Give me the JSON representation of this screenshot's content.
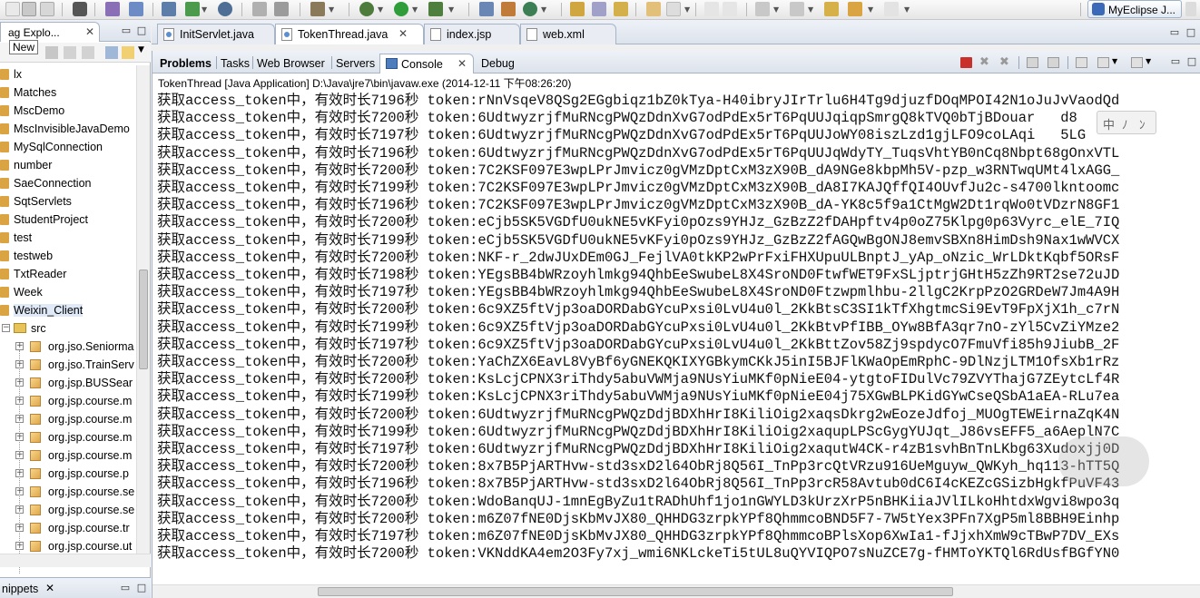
{
  "toolbar": {
    "perspective_label": "MyEclipse J...",
    "icons": [
      "new-icon",
      "save-icon",
      "print-icon",
      "debug-icon",
      "run-icon",
      "server-icon",
      "deploy-icon",
      "search-icon",
      "back-icon",
      "forward-icon"
    ]
  },
  "tooltip": {
    "text": "New"
  },
  "package_explorer": {
    "tab_label": "ag Explo...",
    "tab_close": "✕",
    "items": [
      {
        "label": "lx",
        "kind": "project"
      },
      {
        "label": "Matches",
        "kind": "project"
      },
      {
        "label": "MscDemo",
        "kind": "project"
      },
      {
        "label": "MscInvisibleJavaDemo",
        "kind": "project"
      },
      {
        "label": "MySqlConnection",
        "kind": "project"
      },
      {
        "label": "number",
        "kind": "project"
      },
      {
        "label": "SaeConnection",
        "kind": "project"
      },
      {
        "label": "SqtServlets",
        "kind": "project"
      },
      {
        "label": "StudentProject",
        "kind": "project"
      },
      {
        "label": "test",
        "kind": "project"
      },
      {
        "label": "testweb",
        "kind": "project"
      },
      {
        "label": "TxtReader",
        "kind": "project"
      },
      {
        "label": "Week",
        "kind": "project"
      },
      {
        "label": "Weixin_Client",
        "kind": "project",
        "selected": true
      },
      {
        "label": "src",
        "kind": "src"
      },
      {
        "label": "org.jso.Seniorma",
        "kind": "package"
      },
      {
        "label": "org.jso.TrainServ",
        "kind": "package"
      },
      {
        "label": "org.jsp.BUSSear",
        "kind": "package"
      },
      {
        "label": "org.jsp.course.m",
        "kind": "package"
      },
      {
        "label": "org.jsp.course.m",
        "kind": "package"
      },
      {
        "label": "org.jsp.course.m",
        "kind": "package"
      },
      {
        "label": "org.jsp.course.m",
        "kind": "package"
      },
      {
        "label": "org.jsp.course.p",
        "kind": "package"
      },
      {
        "label": "org.jsp.course.se",
        "kind": "package"
      },
      {
        "label": "org.jsp.course.se",
        "kind": "package"
      },
      {
        "label": "org.jsp.course.tr",
        "kind": "package"
      },
      {
        "label": "org.jsp.course.ut",
        "kind": "package"
      }
    ]
  },
  "snippets": {
    "label": "nippets",
    "close": "✕"
  },
  "editor_tabs": [
    {
      "label": "InitServlet.java",
      "type": "java"
    },
    {
      "label": "TokenThread.java",
      "type": "java",
      "active": true,
      "close": "✕"
    },
    {
      "label": "index.jsp",
      "type": "jsp"
    },
    {
      "label": "web.xml",
      "type": "xml"
    }
  ],
  "console": {
    "tabs": [
      "Problems",
      "Tasks",
      "Web Browser",
      "Servers",
      "Console",
      "Debug"
    ],
    "active_tab": "Console",
    "close": "✕",
    "header": "TokenThread [Java Application] D:\\Java\\jre7\\bin\\javaw.exe (2014-12-11 下午08:26:20)",
    "ime_chars": [
      "中",
      "ﾉ",
      "ﾝ"
    ],
    "lines": [
      "获取access_token中，有效时长7196秒 token:rNnVsqeV8QSg2EGgbiqz1bZ0kTya-H40ibryJIrTrlu6H4Tg9djuzfDOqMPOI42N1oJuJvVaodQd",
      "获取access_token中，有效时长7200秒 token:6UdtwyzrjfMuRNcgPWQzDdnXvG7odPdEx5rT6PqUUJqiqpSmrgQ8kTVQ0bTjBDouar   d8",
      "获取access_token中，有效时长7197秒 token:6UdtwyzrjfMuRNcgPWQzDdnXvG7odPdEx5rT6PqUUJoWY08iszLzd1gjLFO9coLAqi   5LG",
      "获取access_token中，有效时长7196秒 token:6UdtwyzrjfMuRNcgPWQzDdnXvG7odPdEx5rT6PqUUJqWdyTY_TuqsVhtYB0nCq8Nbpt68gOnxVTL",
      "获取access_token中，有效时长7200秒 token:7C2KSF097E3wpLPrJmvicz0gVMzDptCxM3zX90B_dA9NGe8kbpMh5V-pzp_w3RNTwqUMt4lxAGG_",
      "获取access_token中，有效时长7199秒 token:7C2KSF097E3wpLPrJmvicz0gVMzDptCxM3zX90B_dA8I7KAJQffQI4OUvfJu2c-s4700lkntoomc",
      "获取access_token中，有效时长7196秒 token:7C2KSF097E3wpLPrJmvicz0gVMzDptCxM3zX90B_dA-YK8c5f9a1CtMgW2Dt1rqWo0tVDzrN8GF1",
      "获取access_token中，有效时长7200秒 token:eCjb5SK5VGDfU0ukNE5vKFyi0pOzs9YHJz_GzBzZ2fDAHpftv4p0oZ75Klpg0p63Vyrc_elE_7IQ",
      "获取access_token中，有效时长7199秒 token:eCjb5SK5VGDfU0ukNE5vKFyi0pOzs9YHJz_GzBzZ2fAGQwBgONJ8emvSBXn8HimDsh9Nax1wWVCX",
      "获取access_token中，有效时长7200秒 token:NKF-r_2dwJUxDEm0GJ_FejlVA0tkKP2wPrFxiFHXUpuULBnptJ_yAp_oNzic_WrLDktKqbf5ORsF",
      "获取access_token中，有效时长7198秒 token:YEgsBB4bWRzoyhlmkg94QhbEeSwubeL8X4SroND0FtwfWET9FxSLjptrjGHtH5zZh9RT2se72uJD",
      "获取access_token中，有效时长7197秒 token:YEgsBB4bWRzoyhlmkg94QhbEeSwubeL8X4SroND0Ftzwpmlhbu-2llgC2KrpPzO2GRDeW7Jm4A9H",
      "获取access_token中，有效时长7200秒 token:6c9XZ5ftVjp3oaDORDabGYcuPxsi0LvU4u0l_2KkBtsC3SI1kTfXhgtmcSi9EvT9FpXjX1h_c7rN",
      "获取access_token中，有效时长7199秒 token:6c9XZ5ftVjp3oaDORDabGYcuPxsi0LvU4u0l_2KkBtvPfIBB_OYw8BfA3qr7nO-zYl5CvZiYMze2",
      "获取access_token中，有效时长7197秒 token:6c9XZ5ftVjp3oaDORDabGYcuPxsi0LvU4u0l_2KkBttZov58Zj9spdycO7FmuVfi85h9JiubB_2F",
      "获取access_token中，有效时长7200秒 token:YaChZX6EavL8VyBf6yGNEKQKIXYGBkymCKkJ5inI5BJFlKWaOpEmRphC-9DlNzjLTM1OfsXb1rRz",
      "获取access_token中，有效时长7200秒 token:KsLcjCPNX3riThdy5abuVWMja9NUsYiuMKf0pNieE04-ytgtoFIDulVc79ZVYThajG7ZEytcLf4R",
      "获取access_token中，有效时长7199秒 token:KsLcjCPNX3riThdy5abuVWMja9NUsYiuMKf0pNieE04j75XGwBLPKidGYwCseQSbA1aEA-RLu7ea",
      "获取access_token中，有效时长7200秒 token:6UdtwyzrjfMuRNcgPWQzDdjBDXhHrI8KiliOig2xaqsDkrg2wEozeJdfoj_MUOgTEWEirnaZqK4N",
      "获取access_token中，有效时长7199秒 token:6UdtwyzrjfMuRNcgPWQzDdjBDXhHrI8KiliOig2xaqupLPScGygYUJqt_J86vsEFF5_a6AeplN7C",
      "获取access_token中，有效时长7197秒 token:6UdtwyzrjfMuRNcgPWQzDdjBDXhHrI8KiliOig2xaqutW4CK-r4zB1svhBnTnLKbg63Xudoxjj0D",
      "获取access_token中，有效时长7200秒 token:8x7B5PjARTHvw-std3sxD2l64ObRj8Q56I_TnPp3rcQtVRzu916UeMguyw_QWKyh_hq113-hTT5Q",
      "获取access_token中，有效时长7196秒 token:8x7B5PjARTHvw-std3sxD2l64ObRj8Q56I_TnPp3rcR58Avtub0dC6I4cKEZcGSizbHgkfPuVF43",
      "获取access_token中，有效时长7200秒 token:WdoBanqUJ-1mnEgByZu1tRADhUhf1jo1nGWYLD3kUrzXrP5nBHKiiaJVlILkoHhtdxWgvi8wpo3q",
      "获取access_token中，有效时长7200秒 token:m6Z07fNE0DjsKbMvJX80_QHHDG3zrpkYPf8QhmmcoBND5F7-7W5tYex3PFn7XgP5ml8BBH9Einhp",
      "获取access_token中，有效时长7197秒 token:m6Z07fNE0DjsKbMvJX80_QHHDG3zrpkYPf8QhmmcoBPlsXop6XwIa1-fJjxhXmW9cTBwP7DV_EXs",
      "获取access_token中，有效时长7200秒 token:VKNddKA4em2O3Fy7xj_wmi6NKLckeTi5tUL8uQYVIQPO7sNuZCE7g-fHMToYKTQl6RdUsfBGfYN0"
    ]
  }
}
